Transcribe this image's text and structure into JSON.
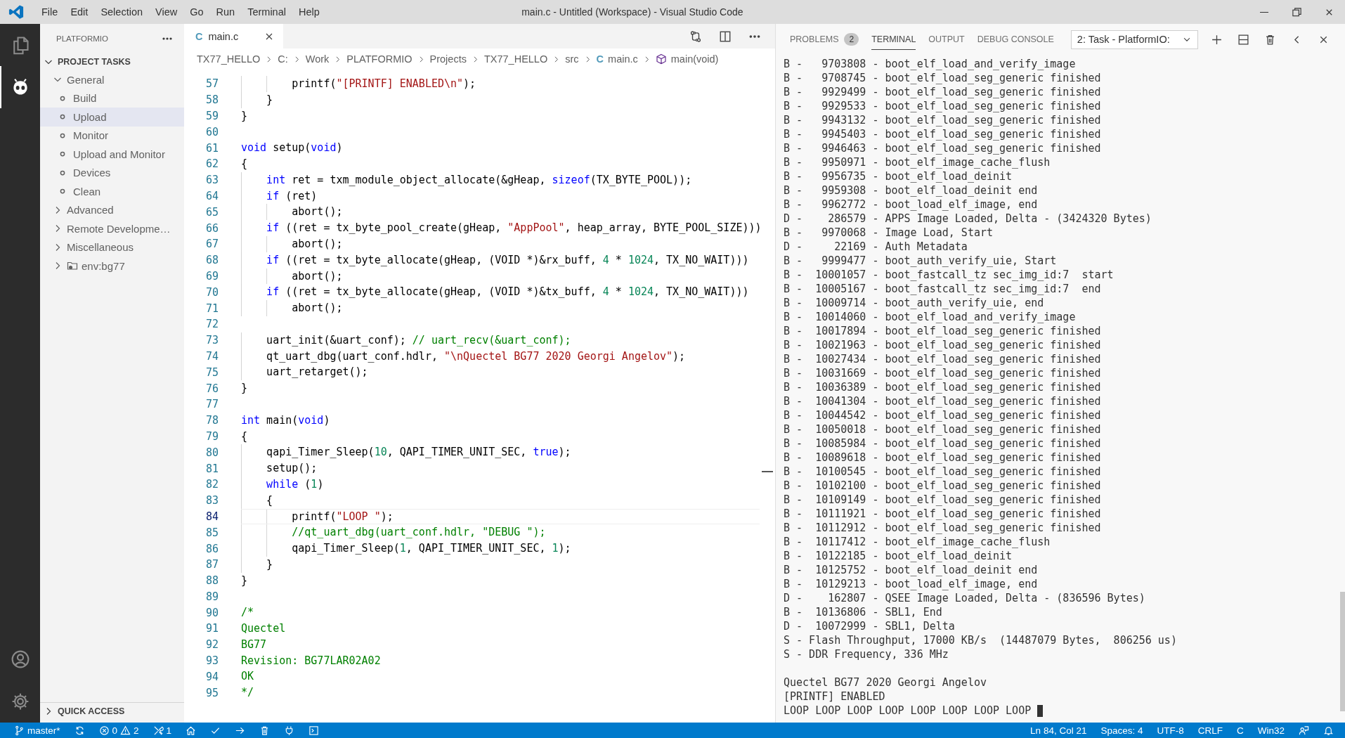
{
  "window": {
    "menus": [
      "File",
      "Edit",
      "Selection",
      "View",
      "Go",
      "Run",
      "Terminal",
      "Help"
    ],
    "title": "main.c - Untitled (Workspace) - Visual Studio Code"
  },
  "sidebar": {
    "title": "PLATFORMIO",
    "sections": [
      {
        "label": "PROJECT TASKS",
        "expanded": true,
        "items": [
          {
            "label": "General",
            "kind": "group",
            "expanded": true,
            "children": [
              {
                "label": "Build",
                "selected": false
              },
              {
                "label": "Upload",
                "selected": true
              },
              {
                "label": "Monitor",
                "selected": false
              },
              {
                "label": "Upload and Monitor",
                "selected": false
              },
              {
                "label": "Devices",
                "selected": false
              },
              {
                "label": "Clean",
                "selected": false
              }
            ]
          },
          {
            "label": "Advanced",
            "kind": "group",
            "expanded": false
          },
          {
            "label": "Remote Developme…",
            "kind": "group",
            "expanded": false
          },
          {
            "label": "Miscellaneous",
            "kind": "group",
            "expanded": false
          },
          {
            "label": "env:bg77",
            "kind": "env",
            "expanded": false
          }
        ]
      }
    ],
    "quick_access": {
      "label": "QUICK ACCESS",
      "expanded": false
    }
  },
  "editor": {
    "tab": {
      "icon_text": "C",
      "label": "main.c",
      "selected": true
    },
    "breadcrumb": [
      {
        "kind": "folder",
        "text": "TX77_HELLO"
      },
      {
        "kind": "folder",
        "text": "C:"
      },
      {
        "kind": "folder",
        "text": "Work"
      },
      {
        "kind": "folder",
        "text": "PLATFORMIO"
      },
      {
        "kind": "folder",
        "text": "Projects"
      },
      {
        "kind": "folder",
        "text": "TX77_HELLO"
      },
      {
        "kind": "folder",
        "text": "src"
      },
      {
        "kind": "file",
        "icon_text": "C",
        "text": "main.c"
      },
      {
        "kind": "symbol",
        "text": "main(void)"
      }
    ],
    "lines": [
      {
        "number": "57",
        "current": false,
        "tokens": [
          {
            "kind": "txt",
            "text": "        printf("
          },
          {
            "kind": "str",
            "text": "\"[PRINTF] ENABLED\\n\""
          },
          {
            "kind": "txt",
            "text": ");"
          }
        ]
      },
      {
        "number": "58",
        "current": false,
        "tokens": [
          {
            "kind": "txt",
            "text": "    }"
          }
        ]
      },
      {
        "number": "59",
        "current": false,
        "tokens": [
          {
            "kind": "txt",
            "text": "}"
          }
        ]
      },
      {
        "number": "60",
        "current": false
      },
      {
        "number": "61",
        "current": false,
        "tokens": [
          {
            "kind": "kw",
            "text": "void"
          },
          {
            "kind": "txt",
            "text": " setup("
          },
          {
            "kind": "kw",
            "text": "void"
          },
          {
            "kind": "txt",
            "text": ")"
          }
        ]
      },
      {
        "number": "62",
        "current": false,
        "tokens": [
          {
            "kind": "txt",
            "text": "{"
          }
        ]
      },
      {
        "number": "63",
        "current": false,
        "tokens": [
          {
            "kind": "kw",
            "text": "    int"
          },
          {
            "kind": "txt",
            "text": " ret = txm_module_object_allocate(&gHeap, "
          },
          {
            "kind": "kw",
            "text": "sizeof"
          },
          {
            "kind": "txt",
            "text": "(TX_BYTE_POOL));"
          }
        ]
      },
      {
        "number": "64",
        "current": false,
        "tokens": [
          {
            "kind": "kw",
            "text": "    if"
          },
          {
            "kind": "txt",
            "text": " (ret)"
          }
        ]
      },
      {
        "number": "65",
        "current": false,
        "tokens": [
          {
            "kind": "txt",
            "text": "        abort();"
          }
        ]
      },
      {
        "number": "66",
        "current": false,
        "tokens": [
          {
            "kind": "kw",
            "text": "    if"
          },
          {
            "kind": "txt",
            "text": " ((ret = tx_byte_pool_create(gHeap, "
          },
          {
            "kind": "str",
            "text": "\"AppPool\""
          },
          {
            "kind": "txt",
            "text": ", heap_array, BYTE_POOL_SIZE)))"
          }
        ]
      },
      {
        "number": "67",
        "current": false,
        "tokens": [
          {
            "kind": "txt",
            "text": "        abort();"
          }
        ]
      },
      {
        "number": "68",
        "current": false,
        "tokens": [
          {
            "kind": "kw",
            "text": "    if"
          },
          {
            "kind": "txt",
            "text": " ((ret = tx_byte_allocate(gHeap, (VOID *)&rx_buff, "
          },
          {
            "kind": "num",
            "text": "4"
          },
          {
            "kind": "txt",
            "text": " * "
          },
          {
            "kind": "num",
            "text": "1024"
          },
          {
            "kind": "txt",
            "text": ", TX_NO_WAIT)))"
          }
        ]
      },
      {
        "number": "69",
        "current": false,
        "tokens": [
          {
            "kind": "txt",
            "text": "        abort();"
          }
        ]
      },
      {
        "number": "70",
        "current": false,
        "tokens": [
          {
            "kind": "kw",
            "text": "    if"
          },
          {
            "kind": "txt",
            "text": " ((ret = tx_byte_allocate(gHeap, (VOID *)&tx_buff, "
          },
          {
            "kind": "num",
            "text": "4"
          },
          {
            "kind": "txt",
            "text": " * "
          },
          {
            "kind": "num",
            "text": "1024"
          },
          {
            "kind": "txt",
            "text": ", TX_NO_WAIT)))"
          }
        ]
      },
      {
        "number": "71",
        "current": false,
        "tokens": [
          {
            "kind": "txt",
            "text": "        abort();"
          }
        ]
      },
      {
        "number": "72",
        "current": false
      },
      {
        "number": "73",
        "current": false,
        "tokens": [
          {
            "kind": "txt",
            "text": "    uart_init(&uart_conf); "
          },
          {
            "kind": "cm",
            "text": "// uart_recv(&uart_conf);"
          }
        ]
      },
      {
        "number": "74",
        "current": false,
        "tokens": [
          {
            "kind": "txt",
            "text": "    qt_uart_dbg(uart_conf.hdlr, "
          },
          {
            "kind": "str",
            "text": "\"\\nQuectel BG77 2020 Georgi Angelov\""
          },
          {
            "kind": "txt",
            "text": ");"
          }
        ]
      },
      {
        "number": "75",
        "current": false,
        "tokens": [
          {
            "kind": "txt",
            "text": "    uart_retarget();"
          }
        ]
      },
      {
        "number": "76",
        "current": false,
        "tokens": [
          {
            "kind": "txt",
            "text": "}"
          }
        ]
      },
      {
        "number": "77",
        "current": false
      },
      {
        "number": "78",
        "current": false,
        "tokens": [
          {
            "kind": "kw",
            "text": "int"
          },
          {
            "kind": "txt",
            "text": " main("
          },
          {
            "kind": "kw",
            "text": "void"
          },
          {
            "kind": "txt",
            "text": ")"
          }
        ]
      },
      {
        "number": "79",
        "current": false,
        "tokens": [
          {
            "kind": "txt",
            "text": "{"
          }
        ]
      },
      {
        "number": "80",
        "current": false,
        "tokens": [
          {
            "kind": "txt",
            "text": "    qapi_Timer_Sleep("
          },
          {
            "kind": "num",
            "text": "10"
          },
          {
            "kind": "txt",
            "text": ", QAPI_TIMER_UNIT_SEC, "
          },
          {
            "kind": "kw",
            "text": "true"
          },
          {
            "kind": "txt",
            "text": ");"
          }
        ]
      },
      {
        "number": "81",
        "current": false,
        "tokens": [
          {
            "kind": "txt",
            "text": "    setup();"
          }
        ]
      },
      {
        "number": "82",
        "current": false,
        "tokens": [
          {
            "kind": "kw",
            "text": "    while"
          },
          {
            "kind": "txt",
            "text": " ("
          },
          {
            "kind": "num",
            "text": "1"
          },
          {
            "kind": "txt",
            "text": ")"
          }
        ]
      },
      {
        "number": "83",
        "current": false,
        "tokens": [
          {
            "kind": "txt",
            "text": "    {"
          }
        ]
      },
      {
        "number": "84",
        "current": true,
        "tokens": [
          {
            "kind": "txt",
            "text": "        printf("
          },
          {
            "kind": "str",
            "text": "\"LOOP \""
          },
          {
            "kind": "txt",
            "text": ");"
          }
        ]
      },
      {
        "number": "85",
        "current": false,
        "tokens": [
          {
            "kind": "cm",
            "text": "        //qt_uart_dbg(uart_conf.hdlr, \"DEBUG \");"
          }
        ]
      },
      {
        "number": "86",
        "current": false,
        "tokens": [
          {
            "kind": "txt",
            "text": "        qapi_Timer_Sleep("
          },
          {
            "kind": "num",
            "text": "1"
          },
          {
            "kind": "txt",
            "text": ", QAPI_TIMER_UNIT_SEC, "
          },
          {
            "kind": "num",
            "text": "1"
          },
          {
            "kind": "txt",
            "text": ");"
          }
        ]
      },
      {
        "number": "87",
        "current": false,
        "tokens": [
          {
            "kind": "txt",
            "text": "    }"
          }
        ]
      },
      {
        "number": "88",
        "current": false,
        "tokens": [
          {
            "kind": "txt",
            "text": "}"
          }
        ]
      },
      {
        "number": "89",
        "current": false
      },
      {
        "number": "90",
        "current": false,
        "tokens": [
          {
            "kind": "cm",
            "text": "/*"
          }
        ]
      },
      {
        "number": "91",
        "current": false,
        "tokens": [
          {
            "kind": "cm",
            "text": "Quectel"
          }
        ]
      },
      {
        "number": "92",
        "current": false,
        "tokens": [
          {
            "kind": "cm",
            "text": "BG77"
          }
        ]
      },
      {
        "number": "93",
        "current": false,
        "tokens": [
          {
            "kind": "cm",
            "text": "Revision: BG77LAR02A02"
          }
        ]
      },
      {
        "number": "94",
        "current": false,
        "tokens": [
          {
            "kind": "cm",
            "text": "OK"
          }
        ]
      },
      {
        "number": "95",
        "current": false,
        "tokens": [
          {
            "kind": "cm",
            "text": "*/"
          }
        ]
      }
    ]
  },
  "panel": {
    "tabs": [
      {
        "label": "PROBLEMS",
        "badge": "2",
        "selected": false
      },
      {
        "label": "TERMINAL",
        "selected": true
      },
      {
        "label": "OUTPUT",
        "selected": false
      },
      {
        "label": "DEBUG CONSOLE",
        "selected": false
      }
    ],
    "terminal_select": "2: Task - PlatformIO:",
    "boot_log": [
      "B -   9703808 - boot_elf_load_and_verify_image",
      "B -   9708745 - boot_elf_load_seg_generic finished",
      "B -   9929499 - boot_elf_load_seg_generic finished",
      "B -   9929533 - boot_elf_load_seg_generic finished",
      "B -   9943132 - boot_elf_load_seg_generic finished",
      "B -   9945403 - boot_elf_load_seg_generic finished",
      "B -   9946463 - boot_elf_load_seg_generic finished",
      "B -   9950971 - boot_elf_image_cache_flush",
      "B -   9956735 - boot_elf_load_deinit",
      "B -   9959308 - boot_elf_load_deinit end",
      "B -   9962772 - boot_load_elf_image, end",
      "D -    286579 - APPS Image Loaded, Delta - (3424320 Bytes)",
      "B -   9970068 - Image Load, Start",
      "D -     22169 - Auth Metadata",
      "B -   9999477 - boot_auth_verify_uie, Start",
      "B -  10001057 - boot_fastcall_tz sec_img_id:7  start",
      "B -  10005167 - boot_fastcall_tz sec_img_id:7  end",
      "B -  10009714 - boot_auth_verify_uie, end",
      "B -  10014060 - boot_elf_load_and_verify_image",
      "B -  10017894 - boot_elf_load_seg_generic finished",
      "B -  10021963 - boot_elf_load_seg_generic finished",
      "B -  10027434 - boot_elf_load_seg_generic finished",
      "B -  10031669 - boot_elf_load_seg_generic finished",
      "B -  10036389 - boot_elf_load_seg_generic finished",
      "B -  10041304 - boot_elf_load_seg_generic finished",
      "B -  10044542 - boot_elf_load_seg_generic finished",
      "B -  10050018 - boot_elf_load_seg_generic finished",
      "B -  10085984 - boot_elf_load_seg_generic finished",
      "B -  10089618 - boot_elf_load_seg_generic finished",
      "B -  10100545 - boot_elf_load_seg_generic finished",
      "B -  10102100 - boot_elf_load_seg_generic finished",
      "B -  10109149 - boot_elf_load_seg_generic finished",
      "B -  10111921 - boot_elf_load_seg_generic finished",
      "B -  10112912 - boot_elf_load_seg_generic finished",
      "B -  10117412 - boot_elf_image_cache_flush",
      "B -  10122185 - boot_elf_load_deinit",
      "B -  10125752 - boot_elf_load_deinit end",
      "B -  10129213 - boot_load_elf_image, end",
      "D -    162807 - QSEE Image Loaded, Delta - (836596 Bytes)",
      "B -  10136806 - SBL1, End",
      "D -  10072999 - SBL1, Delta",
      "S - Flash Throughput, 17000 KB/s  (14487079 Bytes,  806256 us)",
      "S - DDR Frequency, 336 MHz"
    ],
    "program_output": [
      "Quectel BG77 2020 Georgi Angelov",
      "[PRINTF] ENABLED",
      "LOOP LOOP LOOP LOOP LOOP LOOP LOOP LOOP"
    ]
  },
  "status_bar": {
    "branch": "master*",
    "errors": "0",
    "warnings": "2",
    "tasks": "1",
    "right": [
      "Ln 84, Col 21",
      "Spaces: 4",
      "UTF-8",
      "CRLF",
      "C",
      "Win32"
    ]
  }
}
